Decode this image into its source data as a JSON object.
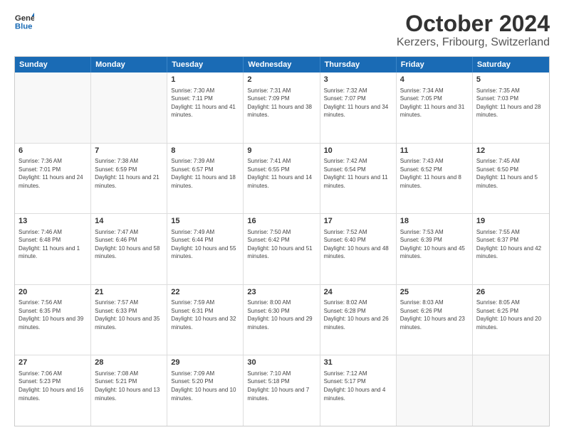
{
  "header": {
    "logo_general": "General",
    "logo_blue": "Blue",
    "title": "October 2024",
    "subtitle": "Kerzers, Fribourg, Switzerland"
  },
  "days_of_week": [
    "Sunday",
    "Monday",
    "Tuesday",
    "Wednesday",
    "Thursday",
    "Friday",
    "Saturday"
  ],
  "weeks": [
    [
      {
        "day": "",
        "sunrise": "",
        "sunset": "",
        "daylight": ""
      },
      {
        "day": "",
        "sunrise": "",
        "sunset": "",
        "daylight": ""
      },
      {
        "day": "1",
        "sunrise": "Sunrise: 7:30 AM",
        "sunset": "Sunset: 7:11 PM",
        "daylight": "Daylight: 11 hours and 41 minutes."
      },
      {
        "day": "2",
        "sunrise": "Sunrise: 7:31 AM",
        "sunset": "Sunset: 7:09 PM",
        "daylight": "Daylight: 11 hours and 38 minutes."
      },
      {
        "day": "3",
        "sunrise": "Sunrise: 7:32 AM",
        "sunset": "Sunset: 7:07 PM",
        "daylight": "Daylight: 11 hours and 34 minutes."
      },
      {
        "day": "4",
        "sunrise": "Sunrise: 7:34 AM",
        "sunset": "Sunset: 7:05 PM",
        "daylight": "Daylight: 11 hours and 31 minutes."
      },
      {
        "day": "5",
        "sunrise": "Sunrise: 7:35 AM",
        "sunset": "Sunset: 7:03 PM",
        "daylight": "Daylight: 11 hours and 28 minutes."
      }
    ],
    [
      {
        "day": "6",
        "sunrise": "Sunrise: 7:36 AM",
        "sunset": "Sunset: 7:01 PM",
        "daylight": "Daylight: 11 hours and 24 minutes."
      },
      {
        "day": "7",
        "sunrise": "Sunrise: 7:38 AM",
        "sunset": "Sunset: 6:59 PM",
        "daylight": "Daylight: 11 hours and 21 minutes."
      },
      {
        "day": "8",
        "sunrise": "Sunrise: 7:39 AM",
        "sunset": "Sunset: 6:57 PM",
        "daylight": "Daylight: 11 hours and 18 minutes."
      },
      {
        "day": "9",
        "sunrise": "Sunrise: 7:41 AM",
        "sunset": "Sunset: 6:55 PM",
        "daylight": "Daylight: 11 hours and 14 minutes."
      },
      {
        "day": "10",
        "sunrise": "Sunrise: 7:42 AM",
        "sunset": "Sunset: 6:54 PM",
        "daylight": "Daylight: 11 hours and 11 minutes."
      },
      {
        "day": "11",
        "sunrise": "Sunrise: 7:43 AM",
        "sunset": "Sunset: 6:52 PM",
        "daylight": "Daylight: 11 hours and 8 minutes."
      },
      {
        "day": "12",
        "sunrise": "Sunrise: 7:45 AM",
        "sunset": "Sunset: 6:50 PM",
        "daylight": "Daylight: 11 hours and 5 minutes."
      }
    ],
    [
      {
        "day": "13",
        "sunrise": "Sunrise: 7:46 AM",
        "sunset": "Sunset: 6:48 PM",
        "daylight": "Daylight: 11 hours and 1 minute."
      },
      {
        "day": "14",
        "sunrise": "Sunrise: 7:47 AM",
        "sunset": "Sunset: 6:46 PM",
        "daylight": "Daylight: 10 hours and 58 minutes."
      },
      {
        "day": "15",
        "sunrise": "Sunrise: 7:49 AM",
        "sunset": "Sunset: 6:44 PM",
        "daylight": "Daylight: 10 hours and 55 minutes."
      },
      {
        "day": "16",
        "sunrise": "Sunrise: 7:50 AM",
        "sunset": "Sunset: 6:42 PM",
        "daylight": "Daylight: 10 hours and 51 minutes."
      },
      {
        "day": "17",
        "sunrise": "Sunrise: 7:52 AM",
        "sunset": "Sunset: 6:40 PM",
        "daylight": "Daylight: 10 hours and 48 minutes."
      },
      {
        "day": "18",
        "sunrise": "Sunrise: 7:53 AM",
        "sunset": "Sunset: 6:39 PM",
        "daylight": "Daylight: 10 hours and 45 minutes."
      },
      {
        "day": "19",
        "sunrise": "Sunrise: 7:55 AM",
        "sunset": "Sunset: 6:37 PM",
        "daylight": "Daylight: 10 hours and 42 minutes."
      }
    ],
    [
      {
        "day": "20",
        "sunrise": "Sunrise: 7:56 AM",
        "sunset": "Sunset: 6:35 PM",
        "daylight": "Daylight: 10 hours and 39 minutes."
      },
      {
        "day": "21",
        "sunrise": "Sunrise: 7:57 AM",
        "sunset": "Sunset: 6:33 PM",
        "daylight": "Daylight: 10 hours and 35 minutes."
      },
      {
        "day": "22",
        "sunrise": "Sunrise: 7:59 AM",
        "sunset": "Sunset: 6:31 PM",
        "daylight": "Daylight: 10 hours and 32 minutes."
      },
      {
        "day": "23",
        "sunrise": "Sunrise: 8:00 AM",
        "sunset": "Sunset: 6:30 PM",
        "daylight": "Daylight: 10 hours and 29 minutes."
      },
      {
        "day": "24",
        "sunrise": "Sunrise: 8:02 AM",
        "sunset": "Sunset: 6:28 PM",
        "daylight": "Daylight: 10 hours and 26 minutes."
      },
      {
        "day": "25",
        "sunrise": "Sunrise: 8:03 AM",
        "sunset": "Sunset: 6:26 PM",
        "daylight": "Daylight: 10 hours and 23 minutes."
      },
      {
        "day": "26",
        "sunrise": "Sunrise: 8:05 AM",
        "sunset": "Sunset: 6:25 PM",
        "daylight": "Daylight: 10 hours and 20 minutes."
      }
    ],
    [
      {
        "day": "27",
        "sunrise": "Sunrise: 7:06 AM",
        "sunset": "Sunset: 5:23 PM",
        "daylight": "Daylight: 10 hours and 16 minutes."
      },
      {
        "day": "28",
        "sunrise": "Sunrise: 7:08 AM",
        "sunset": "Sunset: 5:21 PM",
        "daylight": "Daylight: 10 hours and 13 minutes."
      },
      {
        "day": "29",
        "sunrise": "Sunrise: 7:09 AM",
        "sunset": "Sunset: 5:20 PM",
        "daylight": "Daylight: 10 hours and 10 minutes."
      },
      {
        "day": "30",
        "sunrise": "Sunrise: 7:10 AM",
        "sunset": "Sunset: 5:18 PM",
        "daylight": "Daylight: 10 hours and 7 minutes."
      },
      {
        "day": "31",
        "sunrise": "Sunrise: 7:12 AM",
        "sunset": "Sunset: 5:17 PM",
        "daylight": "Daylight: 10 hours and 4 minutes."
      },
      {
        "day": "",
        "sunrise": "",
        "sunset": "",
        "daylight": ""
      },
      {
        "day": "",
        "sunrise": "",
        "sunset": "",
        "daylight": ""
      }
    ]
  ]
}
